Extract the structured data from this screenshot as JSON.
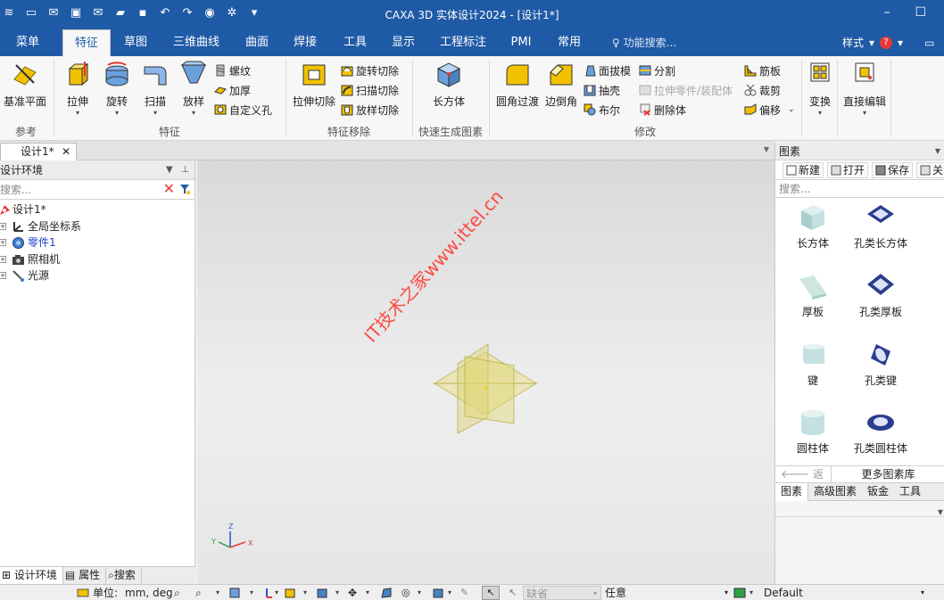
{
  "app": {
    "title": "CAXA 3D 实体设计2024 - [设计1*]",
    "window_controls": [
      "–",
      "☐"
    ]
  },
  "ribbon_tabs": [
    {
      "label": "菜单",
      "active": false
    },
    {
      "label": "特征",
      "active": true
    },
    {
      "label": "草图",
      "active": false
    },
    {
      "label": "三维曲线",
      "active": false
    },
    {
      "label": "曲面",
      "active": false
    },
    {
      "label": "焊接",
      "active": false
    },
    {
      "label": "工具",
      "active": false
    },
    {
      "label": "显示",
      "active": false
    },
    {
      "label": "工程标注",
      "active": false
    },
    {
      "label": "PMI",
      "active": false
    },
    {
      "label": "常用",
      "active": false
    }
  ],
  "feature_search": "功能搜索...",
  "style_menu": "样式",
  "help_glyph": "?",
  "ribbon": {
    "group_labels": [
      "参考",
      "特征",
      "特征移除",
      "快速生成图素",
      "修改"
    ],
    "big_buttons": {
      "datum_plane": "基准平面",
      "extrude": "拉伸",
      "revolve": "旋转",
      "sweep": "扫描",
      "loft": "放样",
      "extrude_cut": "拉伸切除",
      "box": "长方体",
      "fillet": "圆角过渡",
      "chamfer": "边倒角",
      "transform": "变换",
      "direct_edit": "直接编辑"
    },
    "small_buttons": {
      "thread": "螺纹",
      "thicken": "加厚",
      "custom_hole": "自定义孔",
      "revolve_cut": "旋转切除",
      "sweep_cut": "扫描切除",
      "loft_cut": "放样切除",
      "draft": "面拔模",
      "shell": "抽壳",
      "boolean": "布尔",
      "split": "分割",
      "extend_part": "拉伸零件/装配体",
      "delete_body": "删除体",
      "rib": "筋板",
      "trim": "裁剪",
      "offset": "偏移"
    }
  },
  "document_tab": "设计1*",
  "document_tab_close": "✕",
  "left_panel": {
    "title": "设计环境",
    "search_placeholder": "搜索...",
    "clear_glyph": "✕",
    "tree": [
      {
        "label": "设计1*",
        "expandable": false,
        "level": 0,
        "color": "#222222"
      },
      {
        "label": "全局坐标系",
        "expandable": true,
        "level": 1,
        "color": "#222222"
      },
      {
        "label": "零件1",
        "expandable": true,
        "level": 1,
        "color": "#1a3cc8"
      },
      {
        "label": "照相机",
        "expandable": true,
        "level": 1,
        "color": "#222222"
      },
      {
        "label": "光源",
        "expandable": true,
        "level": 1,
        "color": "#222222"
      }
    ],
    "tabs": [
      "设计环境",
      "属性",
      "搜索"
    ]
  },
  "viewport": {
    "watermark": "IT技术之家www.ittel.cn",
    "axis_labels": [
      "Z",
      "Y",
      "X"
    ]
  },
  "right_panel": {
    "title": "图素",
    "tools": [
      "新建",
      "打开",
      "保存",
      "关"
    ],
    "search_placeholder": "搜索...",
    "items": [
      "长方体",
      "孔类长方体",
      "厚板",
      "孔类厚板",
      "键",
      "孔类键",
      "圆柱体",
      "孔类圆柱体"
    ],
    "back_label": "返回",
    "more_label": "更多图素库",
    "tabs": [
      "图素",
      "高级图素",
      "钣金",
      "工具"
    ]
  },
  "status_bar": {
    "unit_label": "单位:",
    "unit_value": "mm, deg",
    "default_field": "缺省",
    "any_label": "任意",
    "default_label": "Default"
  }
}
